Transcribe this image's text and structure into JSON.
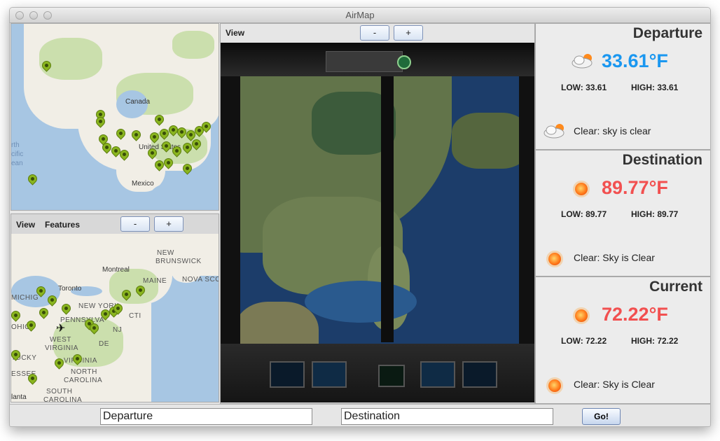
{
  "window": {
    "title": "AirMap"
  },
  "top_map": {
    "labels": {
      "canada": "Canada",
      "united_states": "United States",
      "mexico": "Mexico",
      "north": "rth",
      "pacific": "cific",
      "ocean": "ean"
    }
  },
  "bottom_map": {
    "toolbar": {
      "view_label": "View",
      "features_label": "Features",
      "zoom_out": "-",
      "zoom_in": "+"
    },
    "labels": {
      "new_brunswick_1": "NEW",
      "new_brunswick_2": "BRUNSWICK",
      "montreal": "Montreal",
      "maine": "MAINE",
      "nova_scotia": "NOVA SCO",
      "toronto": "Toronto",
      "michigan": "MICHIG",
      "new_york": "NEW YORK",
      "ohio": "OHIO",
      "pennsylvania": "PENNSYLVA",
      "connecticut": "CTI",
      "nj": "NJ",
      "de": "DE",
      "west_virginia_1": "WEST",
      "west_virginia_2": "VIRGINIA",
      "virginia": "VIRGINIA",
      "kentucky": "TUCKY",
      "north_carolina_1": "NORTH",
      "north_carolina_2": "CAROLINA",
      "tennessee": "ESSEE",
      "south_carolina_1": "SOUTH",
      "south_carolina_2": "CAROLINA",
      "atlanta": "lanta"
    }
  },
  "cockpit": {
    "toolbar": {
      "view_label": "View",
      "zoom_out": "-",
      "zoom_in": "+"
    }
  },
  "weather": {
    "departure": {
      "title": "Departure",
      "temp": "33.61°F",
      "low": "LOW: 33.61",
      "high": "HIGH: 33.61",
      "desc": "Clear: sky is clear",
      "temp_color": "#1a97f0",
      "icon": "cloud-sun-icon"
    },
    "destination": {
      "title": "Destination",
      "temp": "89.77°F",
      "low": "LOW: 89.77",
      "high": "HIGH: 89.77",
      "desc": "Clear: Sky is Clear",
      "temp_color": "#f25050",
      "icon": "sun-icon"
    },
    "current": {
      "title": "Current",
      "temp": "72.22°F",
      "low": "LOW: 72.22",
      "high": "HIGH: 72.22",
      "desc": "Clear: Sky is Clear",
      "temp_color": "#f25050",
      "icon": "sun-icon"
    }
  },
  "bottom_bar": {
    "departure_value": "Departure",
    "destination_value": "Destination",
    "go_label": "Go!"
  }
}
